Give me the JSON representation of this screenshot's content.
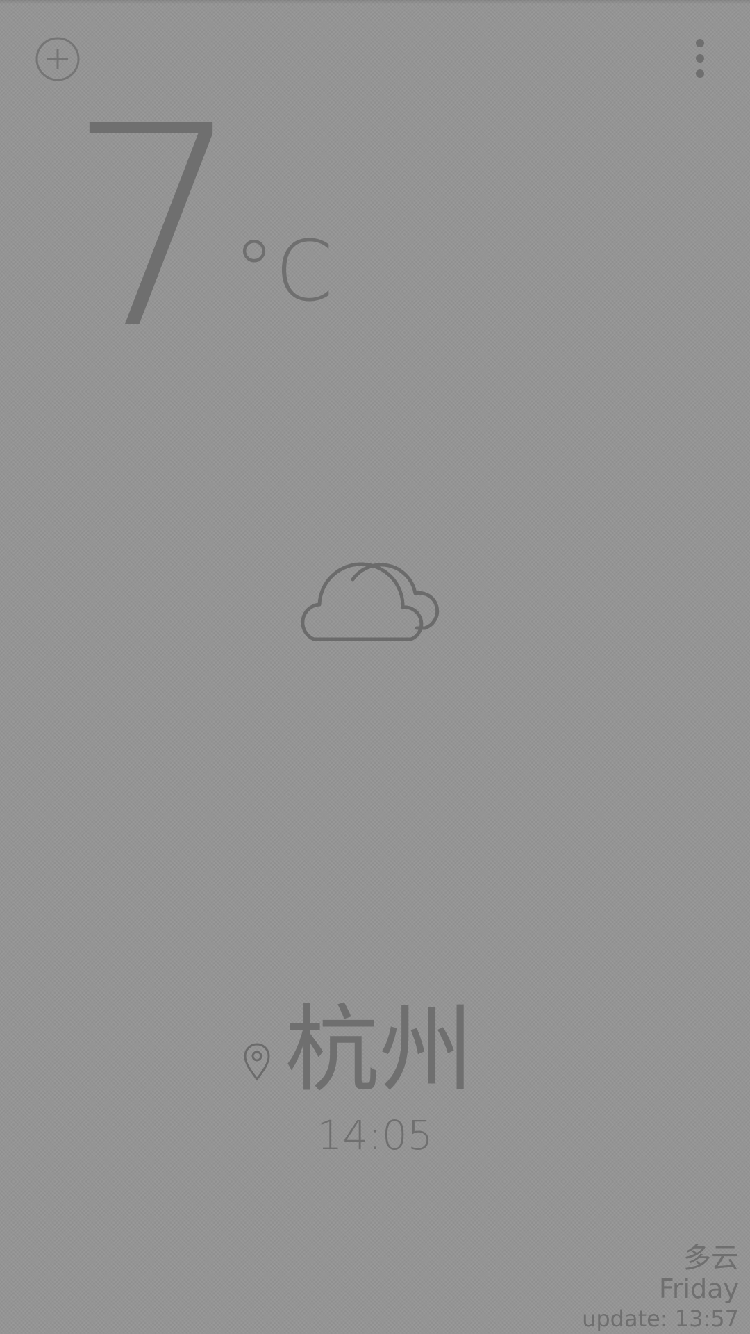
{
  "header": {
    "add_icon": "plus-circle-icon",
    "menu_icon": "more-vertical-icon"
  },
  "current": {
    "temperature": "7",
    "unit": "°C",
    "condition_icon": "cloudy-icon"
  },
  "location": {
    "icon": "map-pin-icon",
    "city": "杭州",
    "time": "14:05"
  },
  "footer": {
    "condition": "多云",
    "weekday": "Friday",
    "update": "update: 13:57"
  }
}
